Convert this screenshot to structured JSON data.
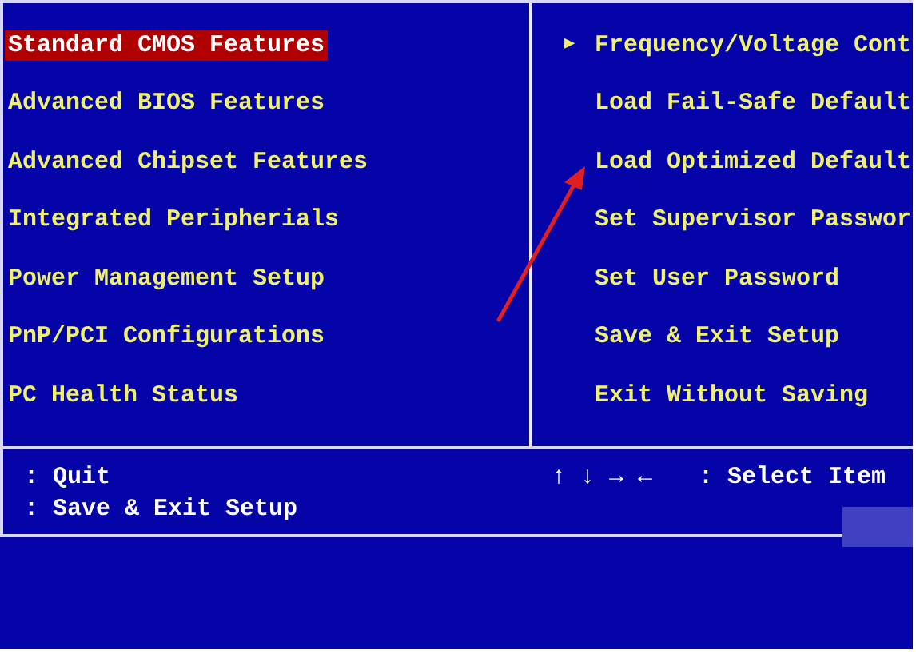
{
  "menu_left": [
    {
      "label": "Standard CMOS Features",
      "selected": true
    },
    {
      "label": "Advanced BIOS Features",
      "selected": false
    },
    {
      "label": "Advanced Chipset Features",
      "selected": false
    },
    {
      "label": "Integrated Peripherials",
      "selected": false
    },
    {
      "label": "Power Management Setup",
      "selected": false
    },
    {
      "label": "PnP/PCI Configurations",
      "selected": false
    },
    {
      "label": "PC Health Status",
      "selected": false
    }
  ],
  "menu_right": [
    {
      "marker": "▶",
      "label": "Frequency/Voltage Cont",
      "selected": false
    },
    {
      "label": "Load Fail-Safe Default",
      "selected": false
    },
    {
      "label": "Load Optimized Default",
      "selected": false
    },
    {
      "label": "Set Supervisor Passwor",
      "selected": false
    },
    {
      "label": "Set User Password",
      "selected": false
    },
    {
      "label": "Save & Exit Setup",
      "selected": false
    },
    {
      "label": "Exit Without Saving",
      "selected": false
    }
  ],
  "help": {
    "left": [
      ": Quit",
      ": Save & Exit Setup"
    ],
    "keys": "↑ ↓ → ←",
    "right": ": Select Item"
  },
  "annotation_arrow": true
}
